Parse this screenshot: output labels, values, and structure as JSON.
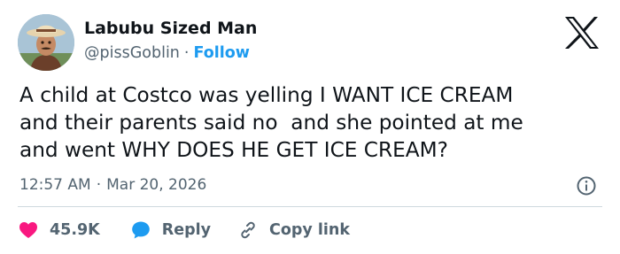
{
  "author": {
    "name": "Labubu Sized Man",
    "handle": "@pissGoblin",
    "separator": "·",
    "follow_label": "Follow"
  },
  "tweet": {
    "text": "A child at Costco was yelling I WANT ICE CREAM\nand their parents said no  and she pointed at me\nand went WHY DOES HE GET ICE CREAM?",
    "time": "12:57 AM",
    "separator": "·",
    "date": "Mar 20, 2026"
  },
  "actions": {
    "like_count": "45.9K",
    "reply_label": "Reply",
    "copy_link_label": "Copy link"
  },
  "icons": {
    "logo": "x-logo-icon",
    "info": "info-icon",
    "like": "heart-icon",
    "reply": "speech-bubble-icon",
    "copy": "link-icon"
  },
  "colors": {
    "text": "#0f1419",
    "secondary": "#536471",
    "link": "#1d9bf0",
    "like": "#f91880",
    "divider": "#cfd9de"
  }
}
